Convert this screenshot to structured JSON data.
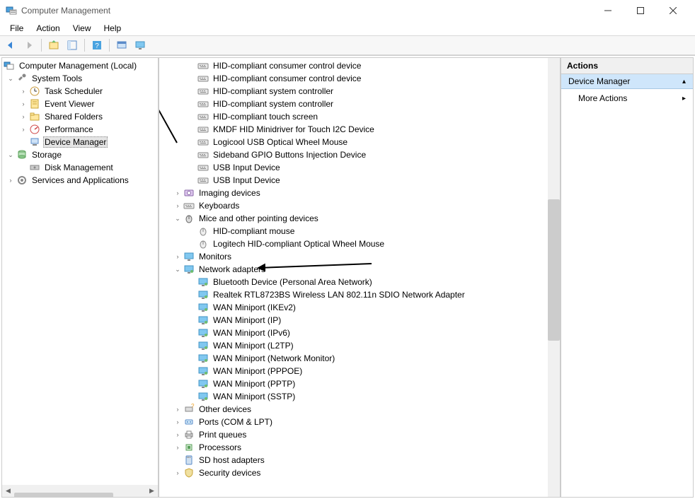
{
  "window": {
    "title": "Computer Management"
  },
  "menubar": [
    "File",
    "Action",
    "View",
    "Help"
  ],
  "left_tree": {
    "root": "Computer Management (Local)",
    "system_tools": {
      "label": "System Tools",
      "children": [
        {
          "label": "Task Scheduler",
          "expandable": true
        },
        {
          "label": "Event Viewer",
          "expandable": true
        },
        {
          "label": "Shared Folders",
          "expandable": true
        },
        {
          "label": "Performance",
          "expandable": true
        },
        {
          "label": "Device Manager",
          "expandable": false,
          "selected": true
        }
      ]
    },
    "storage": {
      "label": "Storage",
      "children": [
        {
          "label": "Disk Management"
        }
      ]
    },
    "services": {
      "label": "Services and Applications",
      "expandable": true
    }
  },
  "devices": {
    "flat_kbd": [
      "HID-compliant consumer control device",
      "HID-compliant consumer control device",
      "HID-compliant system controller",
      "HID-compliant system controller",
      "HID-compliant touch screen",
      "KMDF HID Minidriver for Touch I2C Device",
      "Logicool USB Optical Wheel Mouse",
      "Sideband GPIO Buttons Injection Device",
      "USB Input Device",
      "USB Input Device"
    ],
    "imaging": "Imaging devices",
    "keyboards": "Keyboards",
    "mice": {
      "label": "Mice and other pointing devices",
      "children": [
        "HID-compliant mouse",
        "Logitech HID-compliant Optical Wheel Mouse"
      ]
    },
    "monitors": "Monitors",
    "network": {
      "label": "Network adapters",
      "children": [
        "Bluetooth Device (Personal Area Network)",
        "Realtek RTL8723BS Wireless LAN 802.11n SDIO Network Adapter",
        "WAN Miniport (IKEv2)",
        "WAN Miniport (IP)",
        "WAN Miniport (IPv6)",
        "WAN Miniport (L2TP)",
        "WAN Miniport (Network Monitor)",
        "WAN Miniport (PPPOE)",
        "WAN Miniport (PPTP)",
        "WAN Miniport (SSTP)"
      ]
    },
    "other": "Other devices",
    "ports": "Ports (COM & LPT)",
    "print": "Print queues",
    "processors": "Processors",
    "sd": "SD host adapters",
    "security": "Security devices"
  },
  "actions": {
    "header": "Actions",
    "selected": "Device Manager",
    "more": "More Actions"
  }
}
